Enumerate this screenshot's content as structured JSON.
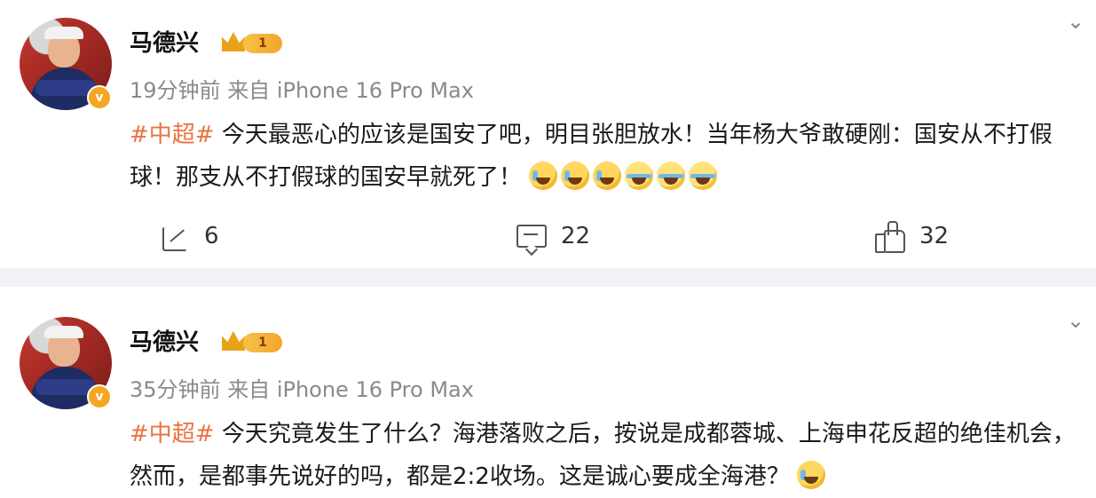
{
  "posts": [
    {
      "username": "马德兴",
      "vip_level": "1",
      "verified_badge": "v",
      "time": "19分钟前",
      "source": "来自 iPhone 16 Pro Max",
      "topic": "#中超#",
      "text": " 今天最恶心的应该是国安了吧，明目张胆放水！当年杨大爷敢硬刚：国安从不打假球！那支从不打假球的国安早就死了！",
      "emojis": [
        "cry-laugh-icon",
        "cry-laugh-icon",
        "cry-laugh-icon",
        "laugh-tears-icon",
        "laugh-tears-icon",
        "laugh-tears-icon"
      ],
      "share_count": "6",
      "comment_count": "22",
      "like_count": "32"
    },
    {
      "username": "马德兴",
      "vip_level": "1",
      "verified_badge": "v",
      "time": "35分钟前",
      "source": "来自 iPhone 16 Pro Max",
      "topic": "#中超#",
      "text": " 今天究竟发生了什么？海港落败之后，按说是成都蓉城、上海申花反超的绝佳机会，然而，是都事先说好的吗，都是2:2收场。这是诚心要成全海港？",
      "emojis": [
        "cry-laugh-icon"
      ]
    }
  ],
  "colors": {
    "topic": "#eb7340",
    "meta": "#8a8a8a",
    "divider": "#f1f2f5",
    "verified": "#f5a623"
  }
}
